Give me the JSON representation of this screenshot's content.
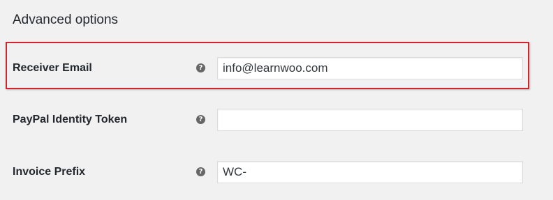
{
  "section": {
    "title": "Advanced options"
  },
  "fields": [
    {
      "label": "Receiver Email",
      "help_icon": "question-circle-icon",
      "value": "info@learnwoo.com",
      "placeholder": ""
    },
    {
      "label": "PayPal Identity Token",
      "help_icon": "question-circle-icon",
      "value": "",
      "placeholder": ""
    },
    {
      "label": "Invoice Prefix",
      "help_icon": "question-circle-icon",
      "value": "WC-",
      "placeholder": ""
    }
  ],
  "highlight": {
    "color": "#d0252b"
  }
}
